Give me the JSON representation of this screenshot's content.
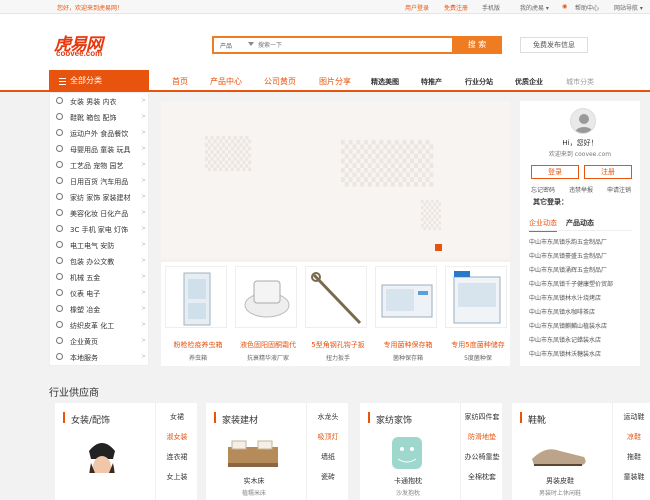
{
  "topbar": {
    "welcome": "您好，欢迎来到虎易网！",
    "links": [
      {
        "label": "用户登录",
        "accent": true
      },
      {
        "label": "免费注册",
        "accent": true
      },
      {
        "label": "手机版",
        "accent": false
      },
      {
        "label": "我的虎易 ▾",
        "accent": false
      },
      {
        "label": "帮助中心",
        "accent": false
      },
      {
        "label": "网站导航 ▾",
        "accent": false
      }
    ]
  },
  "logo": {
    "cn": "虎易网",
    "en": "coovee.com"
  },
  "search": {
    "category": "产品",
    "placeholder": "搜索一下",
    "button": "搜 索"
  },
  "free_button": "免费发布信息",
  "nav": {
    "all_categories": "全部分类",
    "items": [
      {
        "label": "首页",
        "style": "o"
      },
      {
        "label": "产品中心",
        "style": "o"
      },
      {
        "label": "公司黄页",
        "style": "o"
      },
      {
        "label": "图片分享",
        "style": "o"
      },
      {
        "label": "精选美图",
        "style": "b"
      },
      {
        "label": "特推产",
        "style": "b"
      },
      {
        "label": "行业分站",
        "style": "b"
      },
      {
        "label": "优质企业",
        "style": "b"
      },
      {
        "label": "城市分类",
        "style": "g"
      }
    ]
  },
  "categories": [
    "女装 男装 内衣",
    "鞋靴 箱包 配饰",
    "运动户外 食品餐饮",
    "母婴用品 童装 玩具",
    "工艺品 宠物 园艺",
    "日用百货 汽车用品",
    "家纺 家饰 家装建材",
    "美容化妆 日化产品",
    "3C 手机 家电 灯饰",
    "电工电气 安防",
    "包装 办公文教",
    "机械 五金",
    "仪表 电子",
    "橡塑 冶金",
    "纺织皮革 化工",
    "企业黄页",
    "本地服务"
  ],
  "products": [
    {
      "name": "粉枪检疫养虫箱",
      "company": "养虫箱"
    },
    {
      "name": "液色固阳固酮霜代",
      "company": "抗衰精华液厂家"
    },
    {
      "name": "5型角钢孔钩子扳",
      "company": "扭力扳手"
    },
    {
      "name": "专用菌种保存箱",
      "company": "菌种保存箱"
    },
    {
      "name": "专用5度菌种储存",
      "company": "5度菌种保"
    }
  ],
  "user": {
    "greeting": "Hi，您好！",
    "welcome": "欢迎来到 coovee.com",
    "login": "登录",
    "register": "注册",
    "quick": [
      "忘记密码",
      "违禁举报",
      "申请注销"
    ],
    "other_login": "其它登录：",
    "tabs": [
      "企业动态",
      "产品动态"
    ],
    "news": [
      "中山市东凤镇乐韵五金制品厂",
      "中山市东凤镇豪盛五金制品厂",
      "中山市东凤镇涌辉五金制品厂",
      "中山市东凤镇千子健康塑价贸部",
      "中山市东凤镇林水汁烧烤店",
      "中山市东凤镇水咖啡茶店",
      "中山市东凤镇麒麟山植装水店",
      "中山市东凤镇永记蜡装水店",
      "中山市东凤镇林沃糖装水店"
    ]
  },
  "section_title": "行业供应商",
  "industry": [
    {
      "title": "女装/配饰",
      "product": "",
      "company": "",
      "side": [
        "女裙",
        "淑女装",
        "连衣裙",
        "女上装"
      ]
    },
    {
      "title": "家装建材",
      "product": "实木床",
      "company": "植糯米床",
      "side": [
        "水龙头",
        "吸顶灯",
        "墙纸",
        "瓷砖"
      ]
    },
    {
      "title": "家纺家饰",
      "product": "卡通抱枕",
      "company": "沙发抱枕",
      "side": [
        "家纺四件套",
        "防滑地垫",
        "办公椅靠垫",
        "全棉枕套"
      ]
    },
    {
      "title": "鞋靴",
      "product": "男装皮鞋",
      "company": "男装时上休闲鞋",
      "side": [
        "运动鞋",
        "凉鞋",
        "拖鞋",
        "童装鞋"
      ]
    }
  ]
}
